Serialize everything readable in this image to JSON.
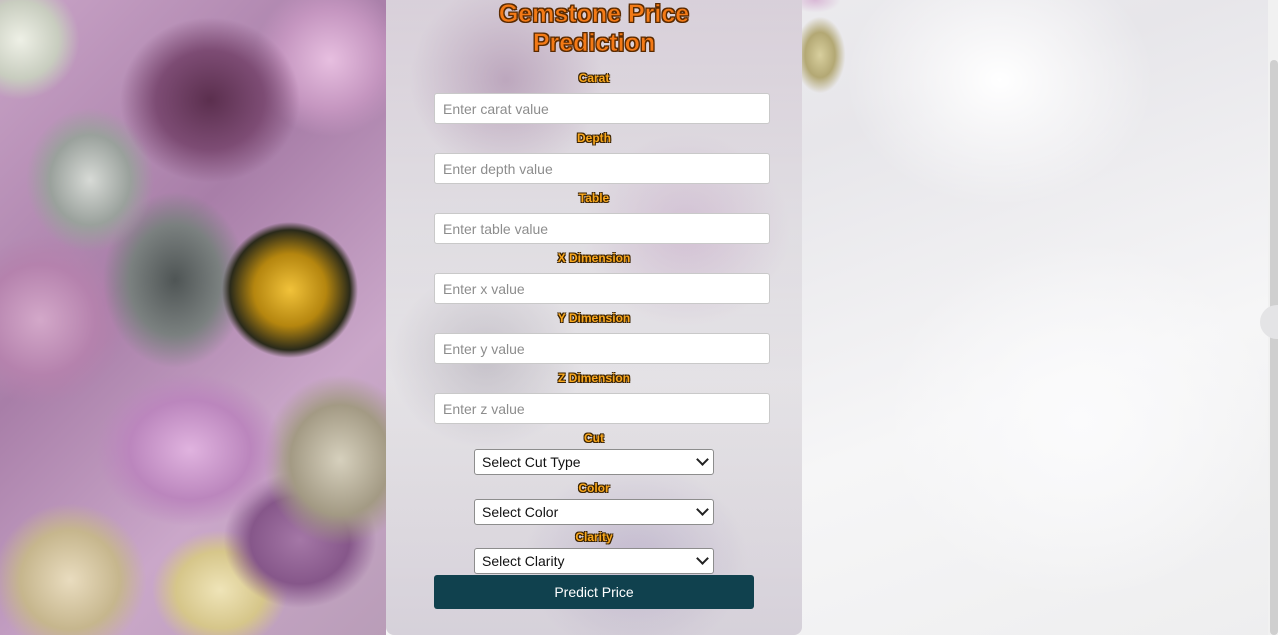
{
  "page": {
    "title_line1": "Gemstone Price",
    "title_line2": "Prediction"
  },
  "form": {
    "fields": [
      {
        "label": "Carat",
        "placeholder": "Enter carat value"
      },
      {
        "label": "Depth",
        "placeholder": "Enter depth value"
      },
      {
        "label": "Table",
        "placeholder": "Enter table value"
      },
      {
        "label": "X Dimension",
        "placeholder": "Enter x value"
      },
      {
        "label": "Y Dimension",
        "placeholder": "Enter y value"
      },
      {
        "label": "Z Dimension",
        "placeholder": "Enter z value"
      }
    ],
    "selects": [
      {
        "label": "Cut",
        "selected": "Select Cut Type"
      },
      {
        "label": "Color",
        "selected": "Select Color"
      },
      {
        "label": "Clarity",
        "selected": "Select Clarity"
      }
    ],
    "submit_label": "Predict Price"
  },
  "theme": {
    "title_color": "#f47a16",
    "label_color": "#f9a81e",
    "button_color": "#10414e"
  },
  "icons": {
    "select_arrow": "chevron-down-icon"
  }
}
